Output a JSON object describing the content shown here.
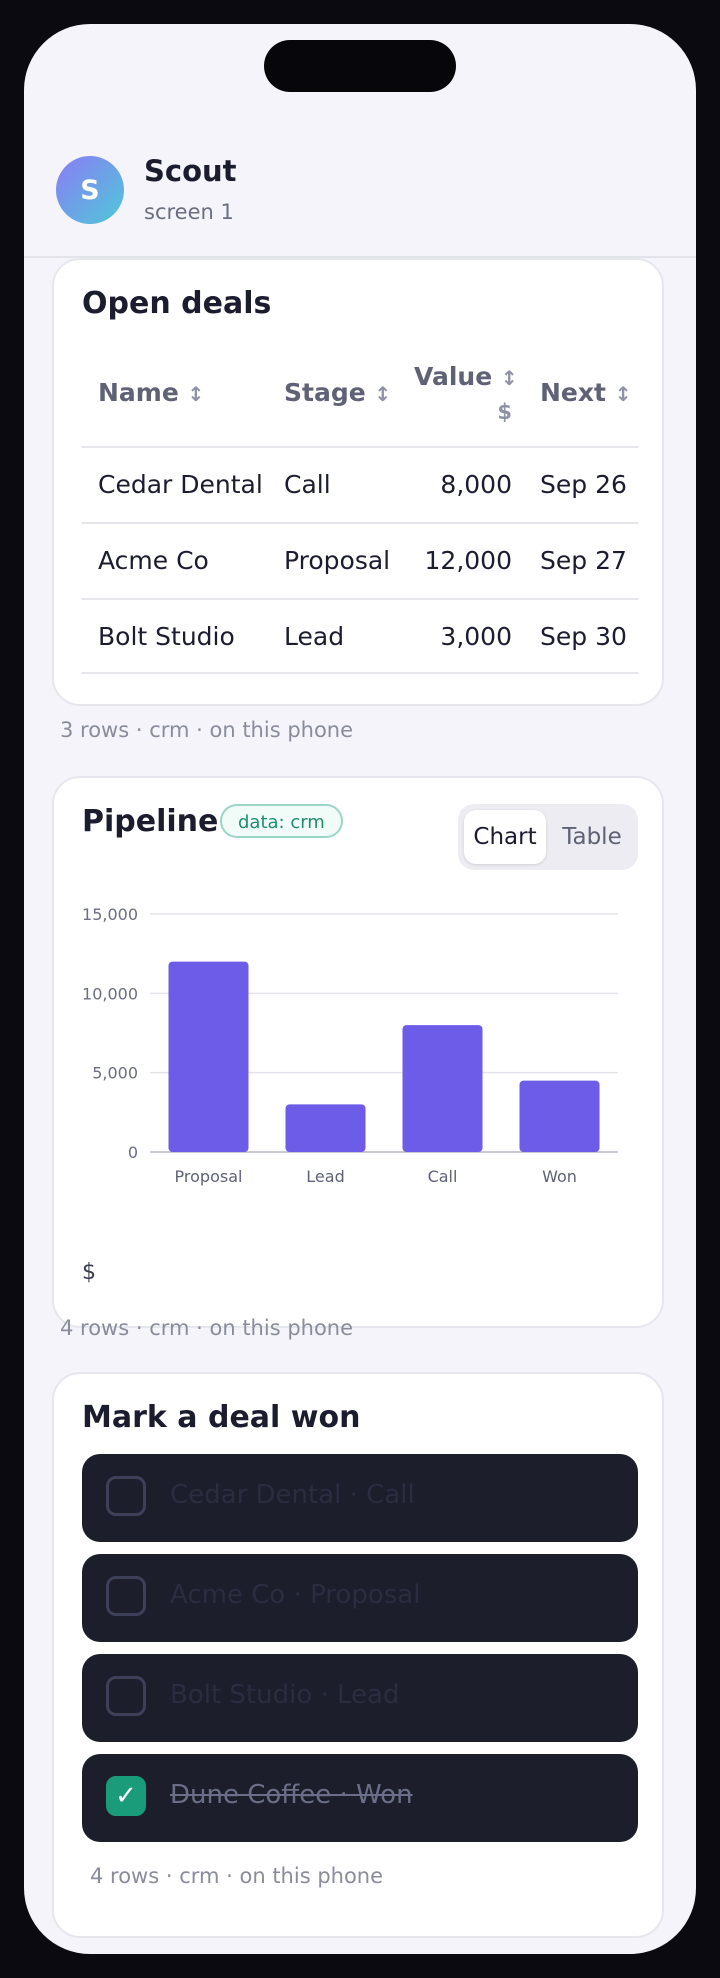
{
  "app": {
    "title": "Scout",
    "subtitle": "screen 1",
    "avatar_letter": "S"
  },
  "deals": {
    "title": "Open deals",
    "columns": [
      {
        "label": "Name",
        "sort": "↕",
        "unit": ""
      },
      {
        "label": "Stage",
        "sort": "↕",
        "unit": ""
      },
      {
        "label": "Value",
        "sort": "↕",
        "unit": "$"
      },
      {
        "label": "Next",
        "sort": "↕",
        "unit": ""
      }
    ],
    "rows": [
      {
        "name": "Cedar Dental",
        "stage": "Call",
        "value": "8,000",
        "next": "Sep 26"
      },
      {
        "name": "Acme Co",
        "stage": "Proposal",
        "value": "12,000",
        "next": "Sep 27"
      },
      {
        "name": "Bolt Studio",
        "stage": "Lead",
        "value": "3,000",
        "next": "Sep 30"
      }
    ],
    "footer": "3 rows · crm · on this phone"
  },
  "pipeline": {
    "title": "Pipeline",
    "badge": "data: crm",
    "toggle": {
      "chart": "Chart",
      "table": "Table",
      "active": "Chart"
    },
    "unit_label": "$",
    "footer": "4 rows · crm · on this phone"
  },
  "chart_data": {
    "type": "bar",
    "categories": [
      "Proposal",
      "Lead",
      "Call",
      "Won"
    ],
    "values": [
      12000,
      3000,
      8000,
      4500
    ],
    "yticks": [
      "0",
      "5,000",
      "10,000",
      "15,000"
    ],
    "ylim": [
      0,
      15000
    ],
    "ylabel": "$",
    "grid": true,
    "bar_color": "#6c5ce7"
  },
  "won": {
    "title": "Mark a deal won",
    "items": [
      {
        "label": "Cedar Dental · Call",
        "checked": false
      },
      {
        "label": "Acme Co · Proposal",
        "checked": false
      },
      {
        "label": "Bolt Studio · Lead",
        "checked": false
      },
      {
        "label": "Dune Coffee · Won",
        "checked": true
      }
    ],
    "footer": "4 rows · crm · on this phone"
  },
  "colors": {
    "accent": "#6c5ce7",
    "success": "#1a9b7a",
    "badge_text": "#1f8e6e"
  }
}
